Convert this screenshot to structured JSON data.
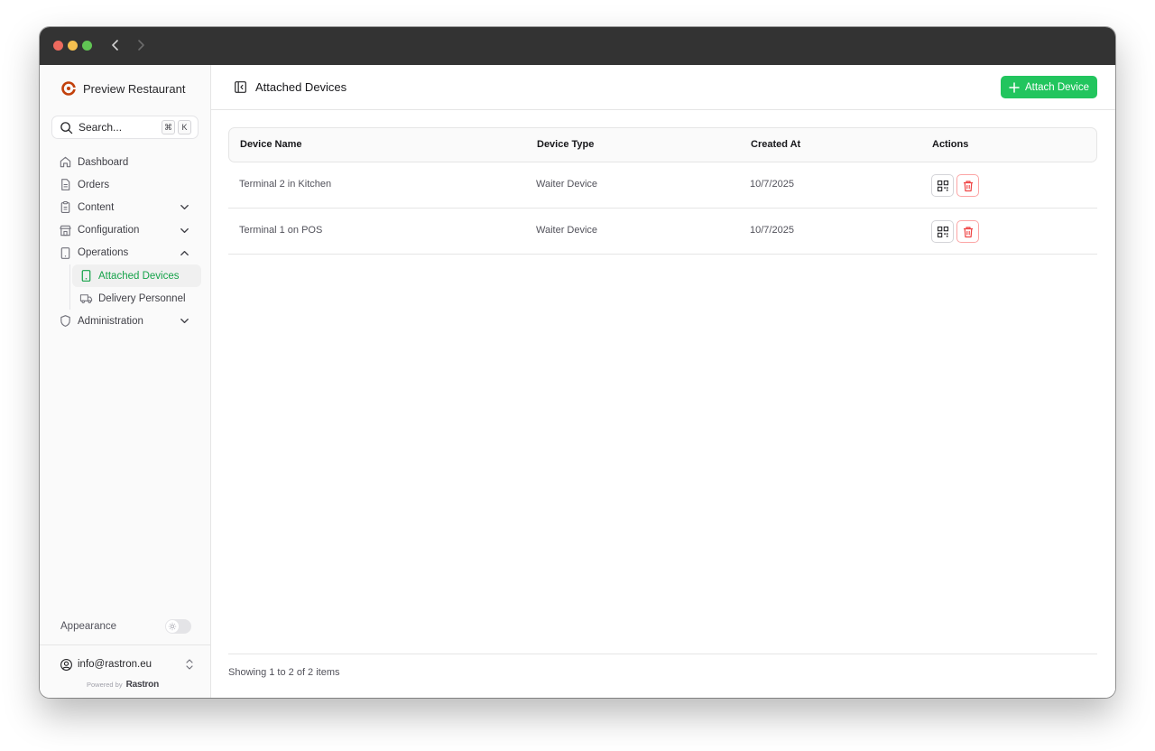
{
  "sidebar": {
    "brand": "Preview Restaurant",
    "search": {
      "placeholder": "Search...",
      "kbd_cmd": "⌘",
      "kbd_key": "K"
    },
    "items": [
      {
        "label": "Dashboard"
      },
      {
        "label": "Orders"
      },
      {
        "label": "Content"
      },
      {
        "label": "Configuration"
      },
      {
        "label": "Operations"
      },
      {
        "label": "Attached Devices"
      },
      {
        "label": "Delivery Personnel"
      },
      {
        "label": "Administration"
      }
    ],
    "appearance_label": "Appearance",
    "user_email": "info@rastron.eu",
    "powered_by": "Powered by",
    "powered_brand": "Rastron"
  },
  "header": {
    "title": "Attached Devices",
    "attach_button": "Attach Device"
  },
  "table": {
    "columns": [
      "Device Name",
      "Device Type",
      "Created At",
      "Actions"
    ],
    "rows": [
      {
        "name": "Terminal 2 in Kitchen",
        "type": "Waiter Device",
        "created": "10/7/2025"
      },
      {
        "name": "Terminal 1 on POS",
        "type": "Waiter Device",
        "created": "10/7/2025"
      }
    ]
  },
  "pagination": {
    "summary": "Showing 1 to 2 of 2 items"
  },
  "colors": {
    "accent": "#22c55e",
    "active_text": "#16a34a",
    "danger": "#ef4444",
    "brand_logo": "#c2410c"
  }
}
